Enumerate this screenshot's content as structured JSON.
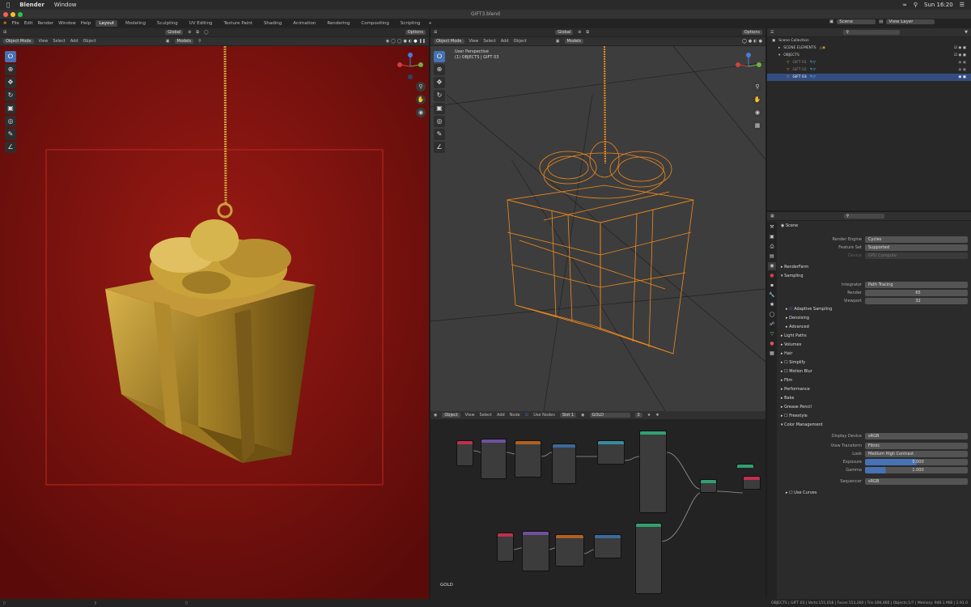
{
  "mac": {
    "app": "Blender",
    "menu_window": "Window",
    "clock": "Sun 16:20"
  },
  "window_title": "GIFT3.blend",
  "topbar": {
    "menus": [
      "File",
      "Edit",
      "Render",
      "Window",
      "Help"
    ],
    "workspaces": [
      "Layout",
      "Modeling",
      "Sculpting",
      "UV Editing",
      "Texture Paint",
      "Shading",
      "Animation",
      "Rendering",
      "Compositing",
      "Scripting"
    ],
    "active_workspace": "Layout",
    "scene": "Scene",
    "view_layer": "View Layer"
  },
  "vp_left": {
    "mode": "Object Mode",
    "menus": [
      "View",
      "Select",
      "Add",
      "Object"
    ],
    "orientation": "Global",
    "snap_label": "Models",
    "options": "Options"
  },
  "vp_right": {
    "mode": "Object Mode",
    "menus": [
      "View",
      "Select",
      "Add",
      "Object"
    ],
    "orientation": "Global",
    "snap_label": "Models",
    "options": "Options",
    "perspective": "User Perspective",
    "object_info": "(1) OBJECTS | GIFT 03"
  },
  "node_editor": {
    "type": "Object",
    "menus": [
      "View",
      "Select",
      "Add",
      "Node"
    ],
    "use_nodes": "Use Nodes",
    "slot": "Slot 1",
    "material": "GOLD",
    "users": "3",
    "label": "GOLD"
  },
  "outliner": {
    "items": [
      {
        "name": "Scene Collection",
        "indent": 0
      },
      {
        "name": "SCENE ELEMENTS",
        "indent": 1
      },
      {
        "name": "OBJECTS",
        "indent": 1
      },
      {
        "name": "GIFT 01",
        "indent": 2
      },
      {
        "name": "GIFT 02",
        "indent": 2
      },
      {
        "name": "GIFT 03",
        "indent": 2,
        "selected": true
      }
    ]
  },
  "properties": {
    "context": "Scene",
    "render_engine_label": "Render Engine",
    "render_engine": "Cycles",
    "feature_set_label": "Feature Set",
    "feature_set": "Supported",
    "device_label": "Device",
    "device": "GPU Compute",
    "panels_top": [
      "RenderFarm",
      "Sampling"
    ],
    "integrator_label": "Integrator",
    "integrator": "Path Tracing",
    "render_label": "Render",
    "render_samples": "65",
    "viewport_label": "Viewport",
    "viewport_samples": "32",
    "subpanels": [
      "Adaptive Sampling",
      "Denoising",
      "Advanced"
    ],
    "panels_mid": [
      "Light Paths",
      "Volumes",
      "Hair",
      "Simplify",
      "Motion Blur",
      "Film",
      "Performance",
      "Bake",
      "Grease Pencil",
      "Freestyle",
      "Color Management"
    ],
    "display_device_label": "Display Device",
    "display_device": "sRGB",
    "view_transform_label": "View Transform",
    "view_transform": "Filmic",
    "look_label": "Look",
    "look": "Medium High Contrast",
    "exposure_label": "Exposure",
    "exposure": "0.000",
    "gamma_label": "Gamma",
    "gamma": "1.000",
    "sequencer_label": "Sequencer",
    "sequencer": "sRGB",
    "use_curves": "Use Curves"
  },
  "statusbar": "OBJECTS | GIFT 03 | Verts:155,018 | Faces:153,260 | Tris:306,460 | Objects:1/7 | Memory: 946.1 MiB | 2.91.0",
  "colors": {
    "accent": "#4772b3",
    "wire": "#f08a1c",
    "gold": "#c9a23a",
    "bg_red": "#7a1310"
  }
}
